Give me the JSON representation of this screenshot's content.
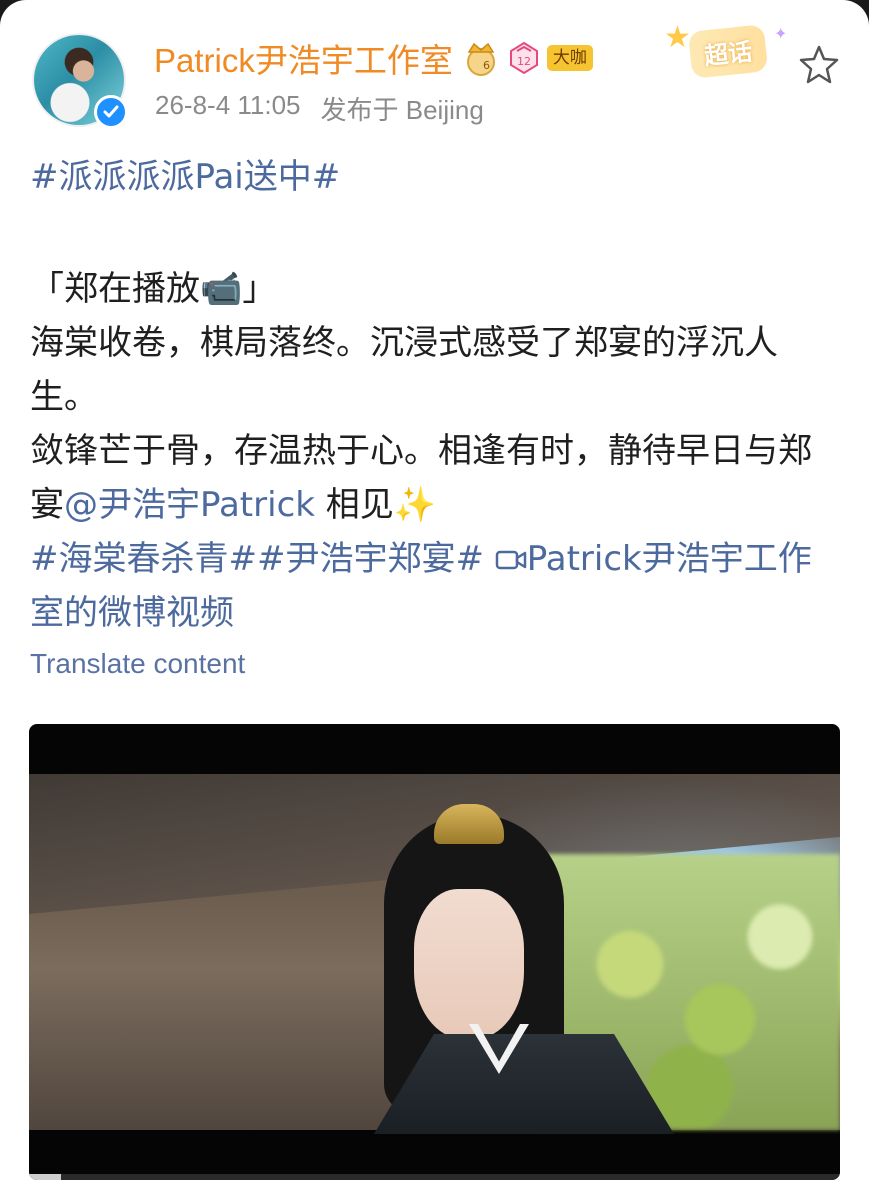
{
  "header": {
    "username": "Patrick尹浩宇工作室",
    "level_badge": "12",
    "vip_badge": "大咖",
    "timestamp": "26-8-4 11:05",
    "location": "发布于 Beijing",
    "supertopic_label": "超话",
    "icons": [
      "avatar",
      "verified-icon",
      "crown-icon",
      "level-icon",
      "supertopic-icon",
      "favorite-star-icon"
    ]
  },
  "post": {
    "hashtag_top": "#派派派派Pai送中#",
    "line_bracket": "「郑在播放📹」",
    "line_1": "海棠收卷，棋局落终。沉浸式感受了郑宴的浮沉人生。",
    "line_2a": "敛锋芒于骨，存温热于心。相逢有时，静待早日与郑宴",
    "mention": "@尹浩宇Patrick",
    "line_2b": " 相见✨",
    "hashtags_bottom": "#海棠春杀青##尹浩宇郑宴#",
    "video_link": "Patrick尹浩宇工作室的微博视频",
    "translate_label": "Translate content"
  },
  "video": {
    "progress": 0.04
  },
  "colors": {
    "username": "#f08a24",
    "link": "#4d6a9e",
    "meta": "#8a8a8a",
    "verified": "#1e90ff",
    "vip": "#f5c430"
  }
}
